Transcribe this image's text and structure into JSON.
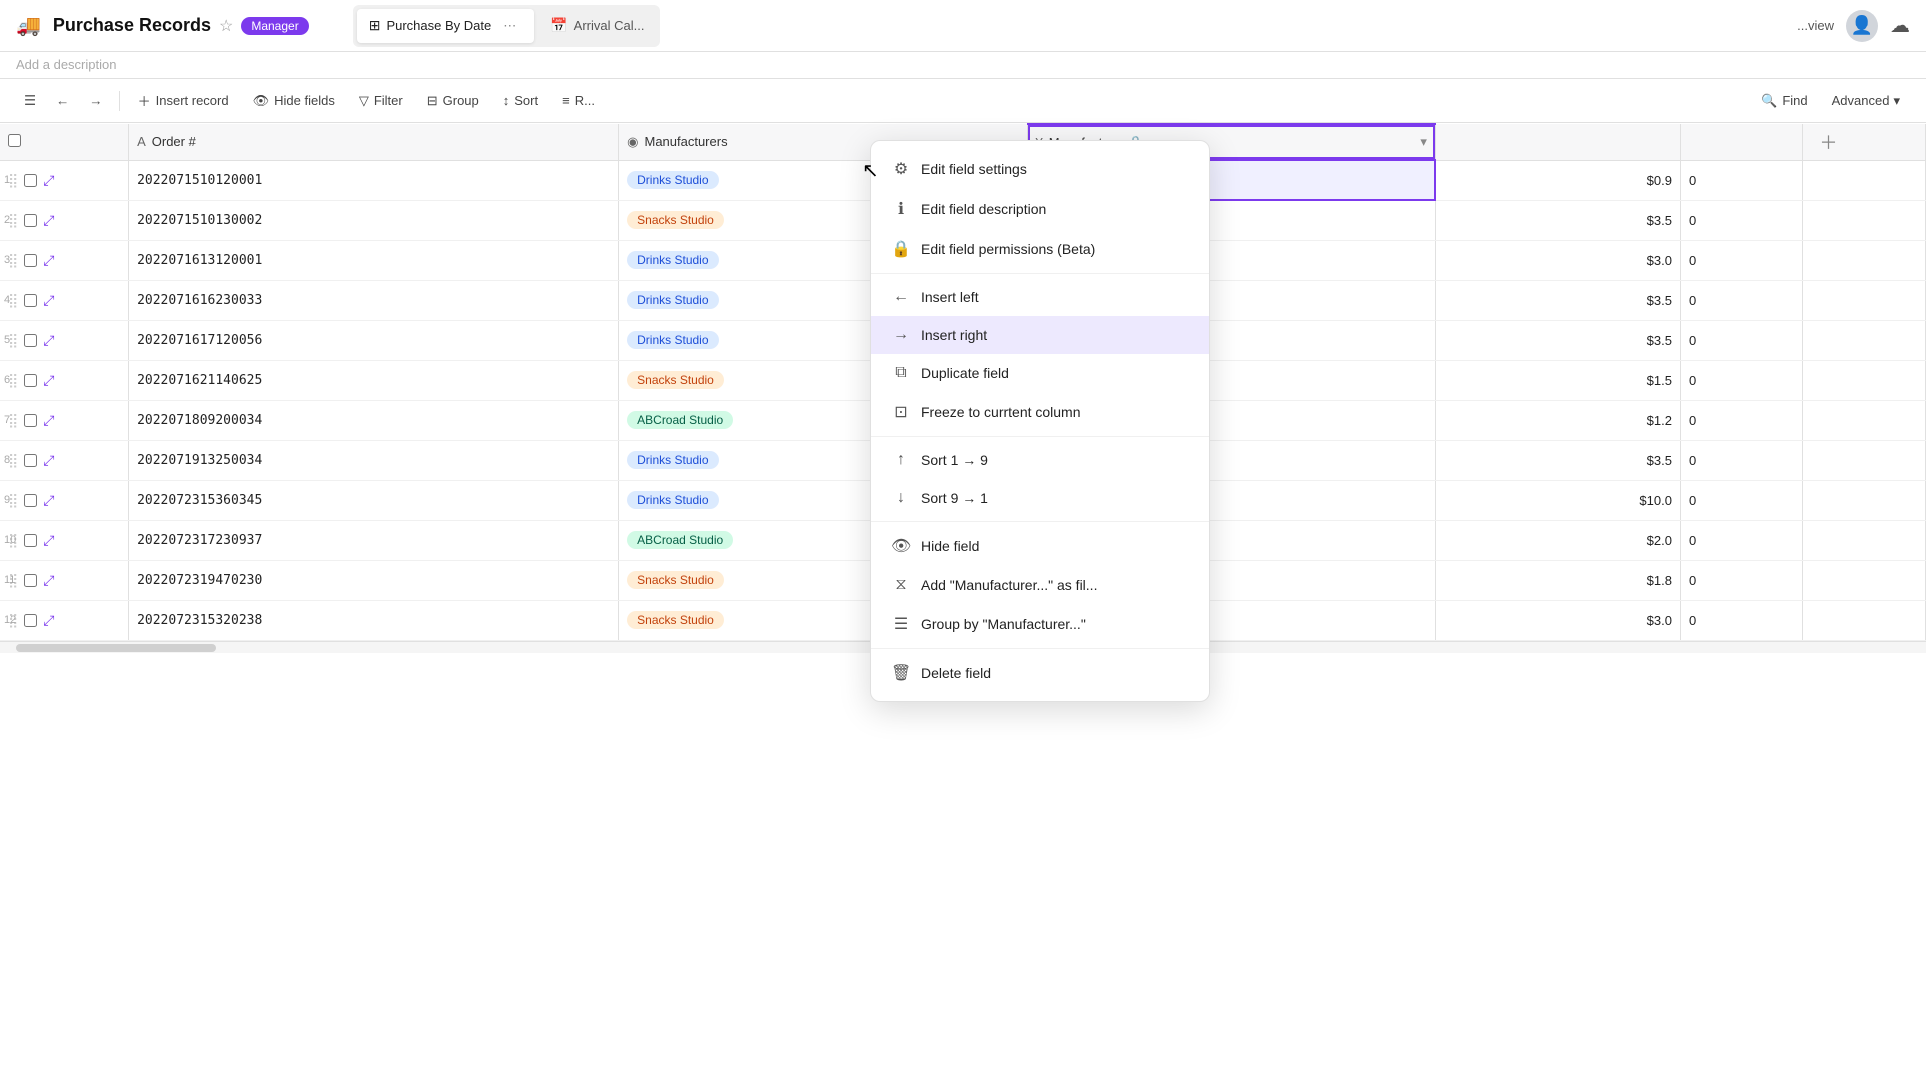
{
  "app": {
    "icon": "🚚",
    "title": "Purchase Records",
    "badge": "Manager",
    "description": "Add a description"
  },
  "tabs": [
    {
      "id": "purchase-by-date",
      "label": "Purchase By Date",
      "icon": "⊞",
      "active": true
    },
    {
      "id": "arrival-cal",
      "label": "Arrival Cal...",
      "icon": "📅",
      "active": false
    }
  ],
  "toolbar": {
    "insert_record": "Insert record",
    "hide_fields": "Hide fields",
    "filter": "Filter",
    "group": "Group",
    "sort": "Sort",
    "row_height": "R...",
    "find": "Find",
    "advanced": "Advanced"
  },
  "columns": [
    {
      "id": "order",
      "label": "Order #",
      "icon": "A",
      "type": "text"
    },
    {
      "id": "manufacturers",
      "label": "Manufacturers",
      "icon": "◉",
      "type": "link"
    },
    {
      "id": "manufactu2",
      "label": "Manufactu...",
      "icon": "¥",
      "type": "currency",
      "locked": true
    },
    {
      "id": "price",
      "label": "",
      "type": "number"
    }
  ],
  "rows": [
    {
      "num": 1,
      "order": "2022071510120001",
      "manufacturer": "Drinks Studio",
      "mfr_tag": "blue",
      "price": "$0.9",
      "rest": "0"
    },
    {
      "num": 2,
      "order": "2022071510130002",
      "manufacturer": "Snacks Studio",
      "mfr_tag": "orange",
      "price": "$3.5",
      "rest": "0"
    },
    {
      "num": 3,
      "order": "2022071613120001",
      "manufacturer": "Drinks Studio",
      "mfr_tag": "blue",
      "price": "$3.0",
      "rest": "0"
    },
    {
      "num": 4,
      "order": "2022071616230033",
      "manufacturer": "Drinks Studio",
      "mfr_tag": "blue",
      "price": "$3.5",
      "rest": "0"
    },
    {
      "num": 5,
      "order": "2022071617120056",
      "manufacturer": "Drinks Studio",
      "mfr_tag": "blue",
      "price": "$3.5",
      "rest": "0"
    },
    {
      "num": 6,
      "order": "2022071621140625",
      "manufacturer": "Snacks Studio",
      "mfr_tag": "orange",
      "price": "$1.5",
      "rest": "0"
    },
    {
      "num": 7,
      "order": "2022071809200034",
      "manufacturer": "ABCroad Studio",
      "mfr_tag": "green",
      "price": "$1.2",
      "rest": "0"
    },
    {
      "num": 8,
      "order": "2022071913250034",
      "manufacturer": "Drinks Studio",
      "mfr_tag": "blue",
      "price": "$3.5",
      "rest": "0"
    },
    {
      "num": 9,
      "order": "2022072315360345",
      "manufacturer": "Drinks Studio",
      "mfr_tag": "blue",
      "price": "$10.0",
      "rest": "0"
    },
    {
      "num": 10,
      "order": "2022072317230937",
      "manufacturer": "ABCroad Studio",
      "mfr_tag": "green",
      "price": "$2.0",
      "rest": "0"
    },
    {
      "num": 11,
      "order": "2022072319470230",
      "manufacturer": "Snacks Studio",
      "mfr_tag": "orange",
      "price": "$1.8",
      "rest": "0"
    },
    {
      "num": 12,
      "order": "2022072315320238",
      "manufacturer": "Snacks Studio",
      "mfr_tag": "orange",
      "price": "$3.0",
      "rest": "0"
    }
  ],
  "context_menu": {
    "items": [
      {
        "id": "edit-field-settings",
        "label": "Edit field settings",
        "icon": "⚙"
      },
      {
        "id": "edit-field-description",
        "label": "Edit field description",
        "icon": "ℹ"
      },
      {
        "id": "edit-field-permissions",
        "label": "Edit field permissions (Beta)",
        "icon": "🔒"
      },
      {
        "separator": true
      },
      {
        "id": "insert-left",
        "label": "Insert left",
        "icon": "←"
      },
      {
        "id": "insert-right",
        "label": "Insert right",
        "icon": "→",
        "highlighted": true
      },
      {
        "id": "duplicate-field",
        "label": "Duplicate field",
        "icon": "⧉"
      },
      {
        "id": "freeze-column",
        "label": "Freeze to currtent column",
        "icon": "⊡"
      },
      {
        "separator": true
      },
      {
        "id": "sort-asc",
        "label": "Sort 1 → 9",
        "icon": "↑"
      },
      {
        "id": "sort-desc",
        "label": "Sort 9 → 1",
        "icon": "↓"
      },
      {
        "separator": true
      },
      {
        "id": "hide-field",
        "label": "Hide field",
        "icon": "👁"
      },
      {
        "id": "add-as-filter",
        "label": "Add \"Manufacturer...\" as fil...",
        "icon": "⧖"
      },
      {
        "id": "group-by",
        "label": "Group by \"Manufacturer...\"",
        "icon": "☰"
      },
      {
        "separator": true
      },
      {
        "id": "delete-field",
        "label": "Delete field",
        "icon": "🗑"
      }
    ]
  }
}
